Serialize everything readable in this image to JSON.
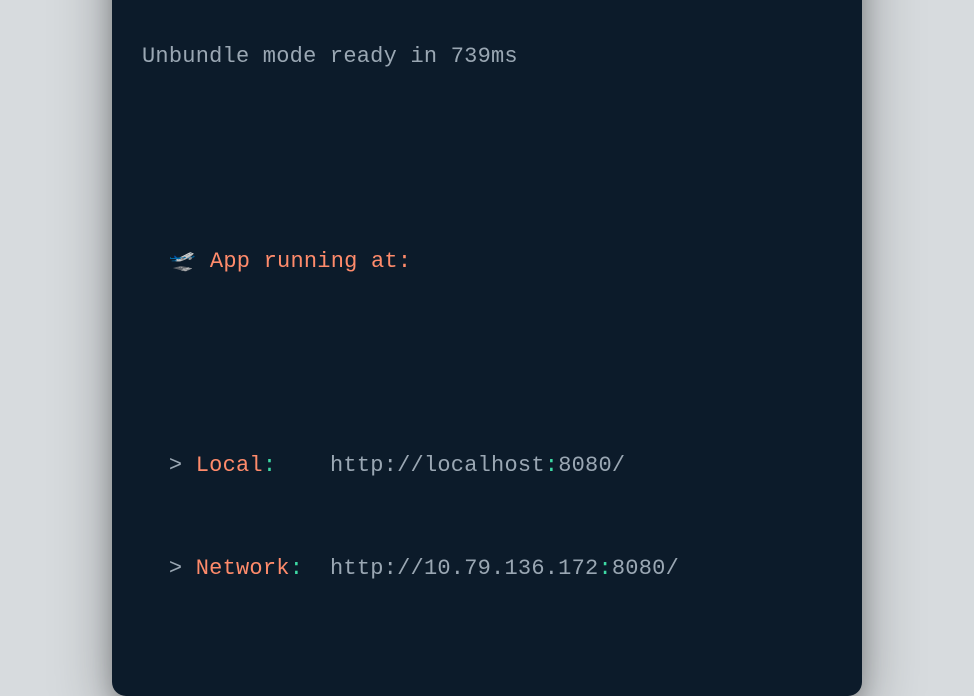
{
  "terminal": {
    "ready_line": {
      "prefix": "Unbundle mode ready in ",
      "time": "739ms"
    },
    "running_line": {
      "icon": "🛫",
      "text": "App running at:"
    },
    "local": {
      "marker": "> ",
      "label": "Local",
      "colon": ":",
      "spacing": "    ",
      "url_prefix": "http://localhost",
      "url_colon": ":",
      "url_port": "8080",
      "url_suffix": "/"
    },
    "network": {
      "marker": "> ",
      "label": "Network",
      "colon": ":",
      "spacing": "  ",
      "url_prefix": "http://10.79.136.172",
      "url_colon": ":",
      "url_port": "8080",
      "url_suffix": "/"
    }
  }
}
